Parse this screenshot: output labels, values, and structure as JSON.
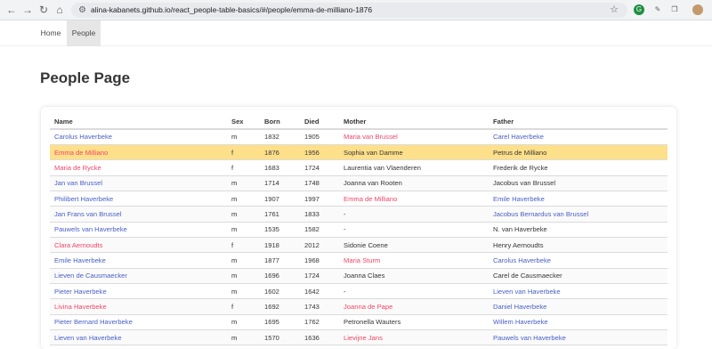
{
  "browser": {
    "url": "alina-kabanets.github.io/react_people-table-basics/#/people/emma-de-milliano-1876",
    "back_icon": "arrow-left-icon",
    "forward_icon": "arrow-right-icon",
    "reload_icon": "reload-icon",
    "home_icon": "home-icon"
  },
  "navbar": {
    "home_label": "Home",
    "people_label": "People"
  },
  "page": {
    "title": "People Page"
  },
  "table": {
    "headers": [
      "Name",
      "Sex",
      "Born",
      "Died",
      "Mother",
      "Father"
    ],
    "rows": [
      {
        "name": "Carolus Haverbeke",
        "sex": "m",
        "born": "1832",
        "died": "1905",
        "mother": "Maria van Brussel",
        "mother_link": true,
        "father": "Carel Haverbeke",
        "father_link": true,
        "selected": false
      },
      {
        "name": "Emma de Milliano",
        "sex": "f",
        "born": "1876",
        "died": "1956",
        "mother": "Sophia van Damme",
        "mother_link": false,
        "father": "Petrus de Milliano",
        "father_link": false,
        "selected": true
      },
      {
        "name": "Maria de Rycke",
        "sex": "f",
        "born": "1683",
        "died": "1724",
        "mother": "Laurentia van Vlaenderen",
        "mother_link": false,
        "father": "Frederik de Rycke",
        "father_link": false,
        "selected": false
      },
      {
        "name": "Jan van Brussel",
        "sex": "m",
        "born": "1714",
        "died": "1748",
        "mother": "Joanna van Rooten",
        "mother_link": false,
        "father": "Jacobus van Brussel",
        "father_link": false,
        "selected": false
      },
      {
        "name": "Philibert Haverbeke",
        "sex": "m",
        "born": "1907",
        "died": "1997",
        "mother": "Emma de Milliano",
        "mother_link": true,
        "father": "Emile Haverbeke",
        "father_link": true,
        "selected": false
      },
      {
        "name": "Jan Frans van Brussel",
        "sex": "m",
        "born": "1761",
        "died": "1833",
        "mother": "-",
        "mother_link": false,
        "father": "Jacobus Bernardus van Brussel",
        "father_link": true,
        "selected": false
      },
      {
        "name": "Pauwels van Haverbeke",
        "sex": "m",
        "born": "1535",
        "died": "1582",
        "mother": "-",
        "mother_link": false,
        "father": "N. van Haverbeke",
        "father_link": false,
        "selected": false
      },
      {
        "name": "Clara Aernoudts",
        "sex": "f",
        "born": "1918",
        "died": "2012",
        "mother": "Sidonie Coene",
        "mother_link": false,
        "father": "Henry Aernoudts",
        "father_link": false,
        "selected": false
      },
      {
        "name": "Emile Haverbeke",
        "sex": "m",
        "born": "1877",
        "died": "1968",
        "mother": "Maria Sturm",
        "mother_link": true,
        "father": "Carolus Haverbeke",
        "father_link": true,
        "selected": false
      },
      {
        "name": "Lieven de Causmaecker",
        "sex": "m",
        "born": "1696",
        "died": "1724",
        "mother": "Joanna Claes",
        "mother_link": false,
        "father": "Carel de Causmaecker",
        "father_link": false,
        "selected": false
      },
      {
        "name": "Pieter Haverbeke",
        "sex": "m",
        "born": "1602",
        "died": "1642",
        "mother": "-",
        "mother_link": false,
        "father": "Lieven van Haverbeke",
        "father_link": true,
        "selected": false
      },
      {
        "name": "Livina Haverbeke",
        "sex": "f",
        "born": "1692",
        "died": "1743",
        "mother": "Joanna de Pape",
        "mother_link": true,
        "father": "Daniel Haverbeke",
        "father_link": true,
        "selected": false
      },
      {
        "name": "Pieter Bernard Haverbeke",
        "sex": "m",
        "born": "1695",
        "died": "1762",
        "mother": "Petronella Wauters",
        "mother_link": false,
        "father": "Willem Haverbeke",
        "father_link": true,
        "selected": false
      },
      {
        "name": "Lieven van Haverbeke",
        "sex": "m",
        "born": "1570",
        "died": "1636",
        "mother": "Lievijne Jans",
        "mother_link": true,
        "father": "Pauwels van Haverbeke",
        "father_link": true,
        "selected": false
      }
    ]
  },
  "colors": {
    "male_link": "#485fc7",
    "female_link": "#f14668",
    "selected_row": "#ffe08a"
  }
}
